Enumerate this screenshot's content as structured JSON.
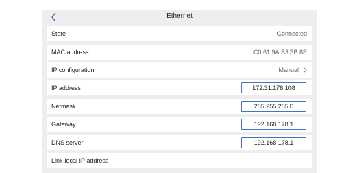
{
  "header": {
    "title": "Ethernet",
    "back_icon": "chevron-left-icon"
  },
  "rows": [
    {
      "label": "State",
      "value": "Connected"
    },
    {
      "label": "MAC address",
      "value": "C0:61:9A:B3:3B:8E"
    },
    {
      "label": "IP configuration",
      "value": "Manual"
    },
    {
      "label": "IP address",
      "value": "172.31.178.108"
    },
    {
      "label": "Netmask",
      "value": "255.255.255.0"
    },
    {
      "label": "Gateway",
      "value": "192.168.178.1"
    },
    {
      "label": "DNS server",
      "value": "192.168.178.1"
    },
    {
      "label": "Link-local IP address",
      "value": ""
    }
  ],
  "colors": {
    "accent": "#4472c4",
    "panel_bg": "#eeeeee",
    "row_bg": "#ffffff"
  }
}
